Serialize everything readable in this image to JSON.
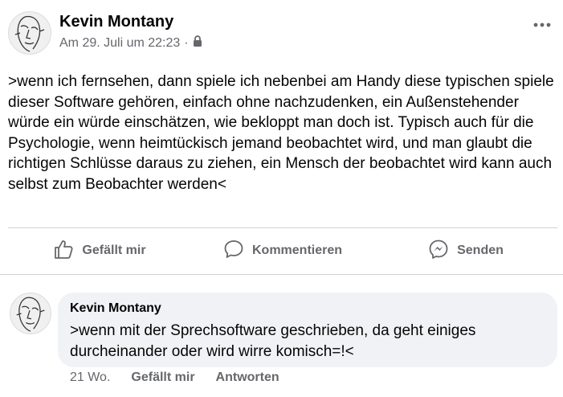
{
  "post": {
    "author": "Kevin Montany",
    "timestamp": "Am 29. Juli um 22:23",
    "separator": "·",
    "privacy_icon": "lock-icon",
    "more_icon": "more-icon",
    "text": ">wenn ich fernsehen, dann spiele ich nebenbei am Handy diese typischen spiele dieser Software gehören, einfach ohne nachzudenken, ein Außenstehender würde ein würde einschätzen, wie bekloppt man doch ist. Typisch auch für die Psychologie, wenn heimtückisch jemand beobachtet wird, und man glaubt die richtigen Schlüsse daraus zu ziehen, ein Mensch der beobachtet wird kann auch selbst zum Beobachter werden<"
  },
  "actions": {
    "like_label": "Gefällt mir",
    "like_icon": "thumbs-up-icon",
    "comment_label": "Kommentieren",
    "comment_icon": "comment-icon",
    "send_label": "Senden",
    "send_icon": "messenger-icon"
  },
  "comment": {
    "author": "Kevin Montany",
    "text": ">wenn mit der Sprechsoftware geschrieben, da geht einiges durcheinander oder wird wirre komisch=!<",
    "age": "21 Wo.",
    "like_label": "Gefällt mir",
    "reply_label": "Antworten"
  },
  "colors": {
    "text": "#050505",
    "secondary": "#65676b",
    "bubble": "#f0f2f5",
    "divider": "#d0d2d6"
  }
}
